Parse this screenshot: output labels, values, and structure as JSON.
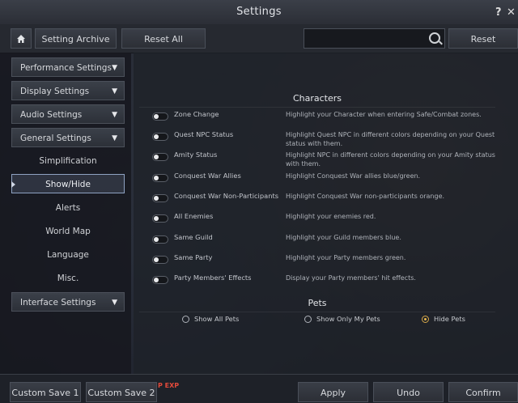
{
  "window": {
    "title": "Settings",
    "help_label": "?",
    "close_label": "✕"
  },
  "toolbar": {
    "setting_archive_label": "Setting Archive",
    "reset_all_label": "Reset All",
    "search_value": "",
    "reset_label": "Reset"
  },
  "sidebar": {
    "items": [
      {
        "label": "Performance Settings",
        "kind": "category",
        "expanded": false
      },
      {
        "label": "Display Settings",
        "kind": "category",
        "expanded": false
      },
      {
        "label": "Audio Settings",
        "kind": "category",
        "expanded": false
      },
      {
        "label": "General Settings",
        "kind": "category",
        "expanded": true
      },
      {
        "label": "Simplification",
        "kind": "sub"
      },
      {
        "label": "Show/Hide",
        "kind": "sub",
        "active": true
      },
      {
        "label": "Alerts",
        "kind": "sub"
      },
      {
        "label": "World Map",
        "kind": "sub"
      },
      {
        "label": "Language",
        "kind": "sub"
      },
      {
        "label": "Misc.",
        "kind": "sub"
      },
      {
        "label": "Interface Settings",
        "kind": "category",
        "expanded": false
      }
    ]
  },
  "characters": {
    "heading": "Characters",
    "options": [
      {
        "name": "Zone Change",
        "desc": "Highlight your Character when entering Safe/Combat zones.",
        "enabled": false
      },
      {
        "name": "Quest NPC Status",
        "desc": "Highlight Quest NPC in different colors depending on your Quest status with them.",
        "enabled": false
      },
      {
        "name": "Amity Status",
        "desc": "Highlight NPC in different colors depending on your Amity status with them.",
        "enabled": false
      },
      {
        "name": "Conquest War Allies",
        "desc": "Highlight Conquest War allies blue/green.",
        "enabled": false
      },
      {
        "name": "Conquest War Non-Participants",
        "desc": "Highlight Conquest War non-participants orange.",
        "enabled": false
      },
      {
        "name": "All Enemies",
        "desc": "Highlight your enemies red.",
        "enabled": false
      },
      {
        "name": "Same Guild",
        "desc": "Highlight your Guild members blue.",
        "enabled": false
      },
      {
        "name": "Same Party",
        "desc": "Highlight your Party members green.",
        "enabled": false
      },
      {
        "name": "Party Members' Effects",
        "desc": "Display your Party members' hit effects.",
        "enabled": false
      }
    ]
  },
  "pets": {
    "heading": "Pets",
    "options": [
      {
        "label": "Show All Pets",
        "selected": false
      },
      {
        "label": "Show Only My Pets",
        "selected": false
      },
      {
        "label": "Hide Pets",
        "selected": true
      }
    ]
  },
  "footer": {
    "custom_save_1_label": "Custom Save 1",
    "custom_save_2_label": "Custom Save 2",
    "apply_label": "Apply",
    "undo_label": "Undo",
    "confirm_label": "Confirm",
    "exp_icon_text": "P EXP"
  },
  "colors": {
    "accent_radio": "#e8b64c",
    "active_border": "#8ea2c2"
  }
}
